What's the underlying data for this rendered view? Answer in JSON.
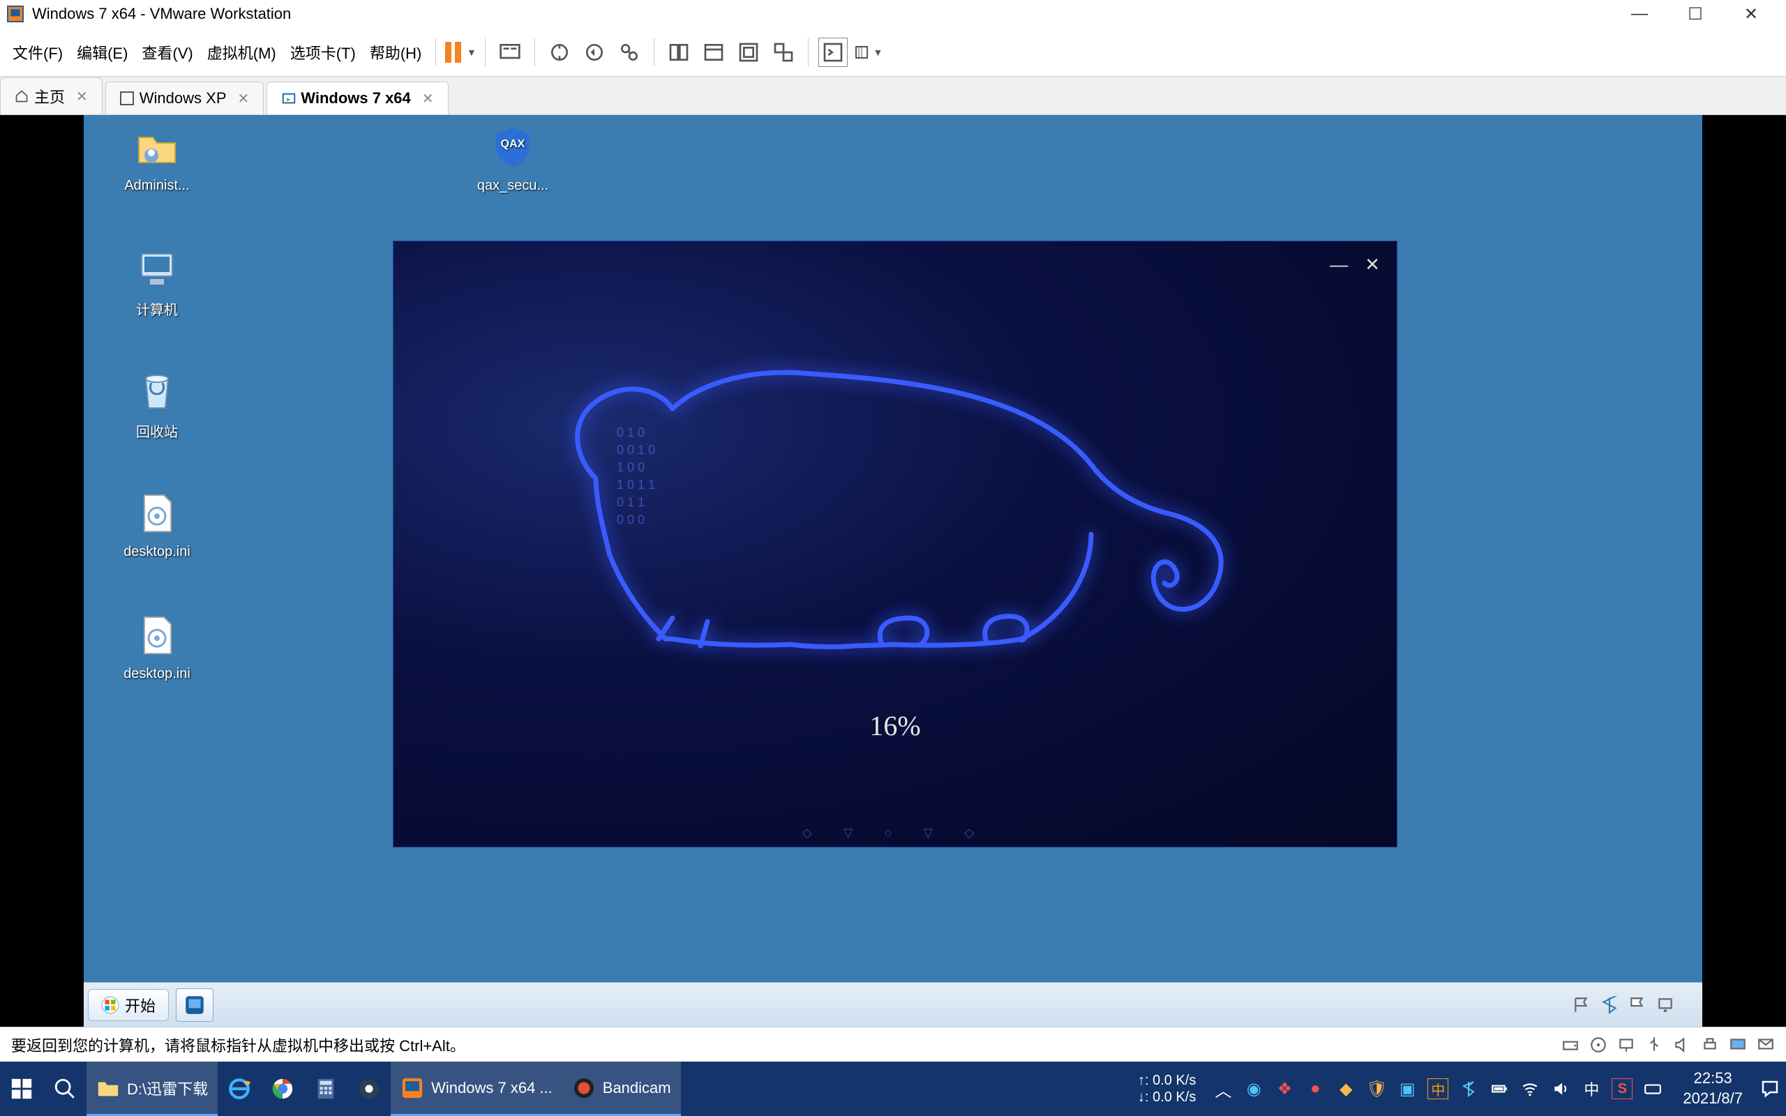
{
  "titlebar": {
    "title": "Windows 7 x64 - VMware Workstation"
  },
  "menubar": {
    "file": "文件(F)",
    "edit": "编辑(E)",
    "view": "查看(V)",
    "vm": "虚拟机(M)",
    "tabs": "选项卡(T)",
    "help": "帮助(H)"
  },
  "tabs": {
    "home": "主页",
    "xp": "Windows XP",
    "win7": "Windows 7 x64"
  },
  "desktop": {
    "admin": "Administ...",
    "computer": "计算机",
    "recycle": "回收站",
    "ini1": "desktop.ini",
    "ini2": "desktop.ini",
    "qax": "qax_secu..."
  },
  "installer": {
    "percent": "16%"
  },
  "guest_taskbar": {
    "start": "开始"
  },
  "statusbar": {
    "hint": "要返回到您的计算机，请将鼠标指针从虚拟机中移出或按 Ctrl+Alt。"
  },
  "host_taskbar": {
    "explorer": "D:\\迅雷下载",
    "vmware": "Windows 7 x64 ...",
    "bandicam": "Bandicam",
    "netspeed_up": "↑: 0.0 K/s",
    "netspeed_down": "↓: 0.0 K/s",
    "ime": "中",
    "time": "22:53",
    "date": "2021/8/7"
  }
}
